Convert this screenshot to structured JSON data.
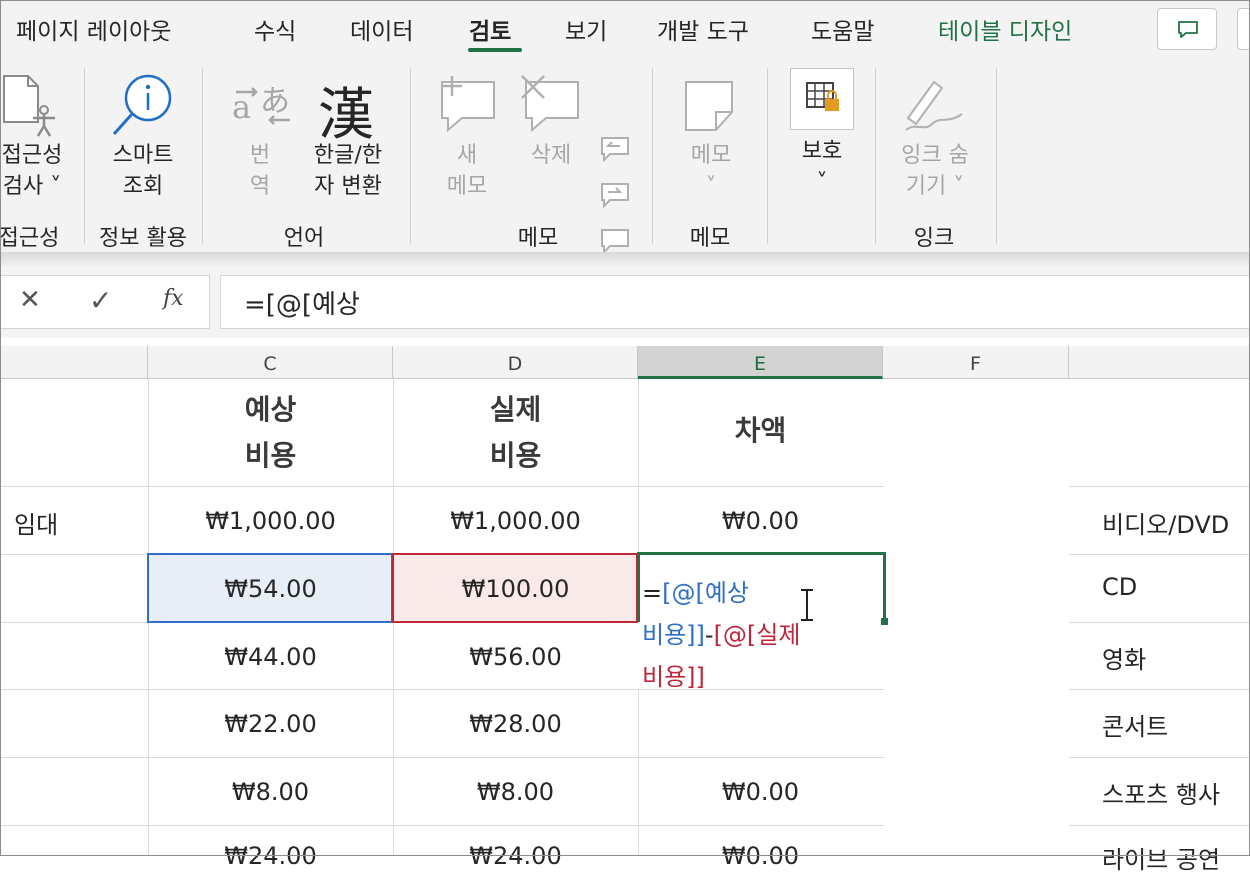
{
  "menu": {
    "tabs": [
      "페이지 레이아웃",
      "수식",
      "데이터",
      "검토",
      "보기",
      "개발 도구",
      "도움말",
      "테이블 디자인"
    ],
    "active_tab": "검토"
  },
  "ribbon": {
    "accessibility_check": [
      "접근성",
      "검사 ˅"
    ],
    "group_accessibility": "접근성",
    "smart_lookup": [
      "스마트",
      "조회"
    ],
    "group_insights": "정보 활용",
    "translate": [
      "번",
      "역"
    ],
    "translate_glyph": "あ",
    "convert_glyph": "漢",
    "hangul_hanja": [
      "한글/한",
      "자 변환"
    ],
    "group_language": "언어",
    "new_comment": [
      "새",
      "메모"
    ],
    "delete_comment": "삭제",
    "group_comments": "메모",
    "notes": [
      "메모",
      "˅"
    ],
    "group_notes": "메모",
    "protect": [
      "보호",
      "˅"
    ],
    "hide_ink": [
      "잉크 숨",
      "기기 ˅"
    ],
    "group_ink": "잉크"
  },
  "formula_bar": {
    "cancel": "✕",
    "enter": "✓",
    "fx": "fx",
    "value": "=[@[예상"
  },
  "columns": [
    "C",
    "D",
    "E",
    "F"
  ],
  "table": {
    "headers": {
      "C": [
        "예상",
        "비용"
      ],
      "D": [
        "실제",
        "비용"
      ],
      "E": "차액"
    },
    "partial_b_row1": "임대",
    "rows": [
      {
        "C": "₩1,000.00",
        "D": "₩1,000.00",
        "E": "₩0.00"
      },
      {
        "C": "₩54.00",
        "D": "₩100.00",
        "E": ""
      },
      {
        "C": "₩44.00",
        "D": "₩56.00",
        "E": ""
      },
      {
        "C": "₩22.00",
        "D": "₩28.00",
        "E": ""
      },
      {
        "C": "₩8.00",
        "D": "₩8.00",
        "E": "₩0.00"
      },
      {
        "C": "₩24.00",
        "D": "₩24.00",
        "E": "₩0.00"
      }
    ]
  },
  "editing_cell": {
    "eq": "=",
    "ref_expected": "[@[예상",
    "ref_expected_2": "비용]]",
    "minus": "-",
    "ref_actual": "[@[실제",
    "ref_actual_2": "비용]]"
  },
  "right_list": [
    "비디오/DVD",
    "CD",
    "영화",
    "콘서트",
    "스포츠 행사",
    "라이브 공연"
  ],
  "colors": {
    "accent_green": "#217346",
    "ref_blue": "#2e6fc9",
    "ref_red": "#c0263a",
    "sel_blue_fill": "#e8eef8",
    "sel_red_fill": "#f9e9e9"
  }
}
